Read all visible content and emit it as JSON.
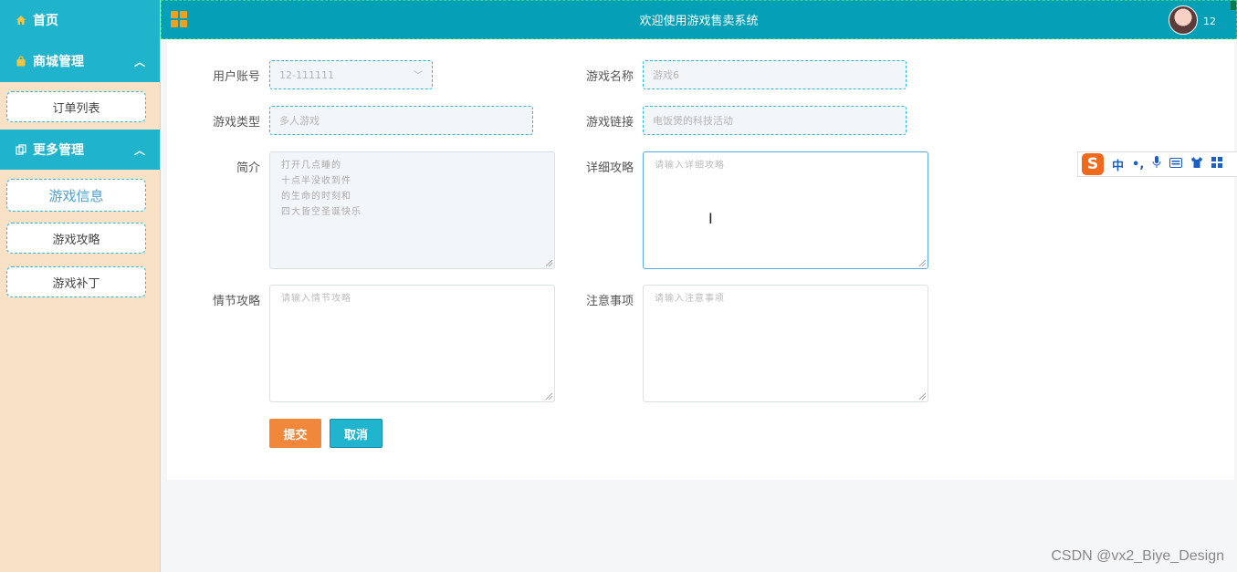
{
  "app": {
    "title": "欢迎使用游戏售卖系统",
    "user_number": "12"
  },
  "sidebar": {
    "home": "首页",
    "groups": [
      {
        "label": "商城管理",
        "expanded": true,
        "items": [
          {
            "label": "订单列表",
            "active": false
          }
        ]
      },
      {
        "label": "更多管理",
        "expanded": true,
        "items": [
          {
            "label": "游戏信息",
            "active": true
          },
          {
            "label": "游戏攻略",
            "active": false
          },
          {
            "label": "游戏补丁",
            "active": false
          }
        ]
      }
    ]
  },
  "form": {
    "account": {
      "label": "用户账号",
      "value": "12-111111"
    },
    "game_name": {
      "label": "游戏名称",
      "value": "游戏6"
    },
    "game_type": {
      "label": "游戏类型",
      "value": "多人游戏"
    },
    "game_link": {
      "label": "游戏链接",
      "value": "电饭煲的科技活动"
    },
    "intro": {
      "label": "简介",
      "lines": [
        "打开几点睡的",
        "十点半没收到件",
        "的生命的时刻和",
        "四大皆空圣诞快乐"
      ]
    },
    "detail_guide": {
      "label": "详细攻略",
      "placeholder": "请输入详细攻略"
    },
    "plot_guide": {
      "label": "情节攻略",
      "placeholder": "请输入情节攻略"
    },
    "notes": {
      "label": "注意事项",
      "placeholder": "请输入注意事项"
    },
    "submit": "提交",
    "cancel": "取消"
  },
  "ime": {
    "logo": "S",
    "mode": "中",
    "punct": "•,"
  },
  "footer": {
    "watermark": "CSDN @vx2_Biye_Design"
  },
  "colors": {
    "accent": "#1fb3cc",
    "topbar": "#05a0b8",
    "sidebar_bg": "#f8e1c4",
    "submit": "#f0873a",
    "cancel": "#21b4cf"
  }
}
